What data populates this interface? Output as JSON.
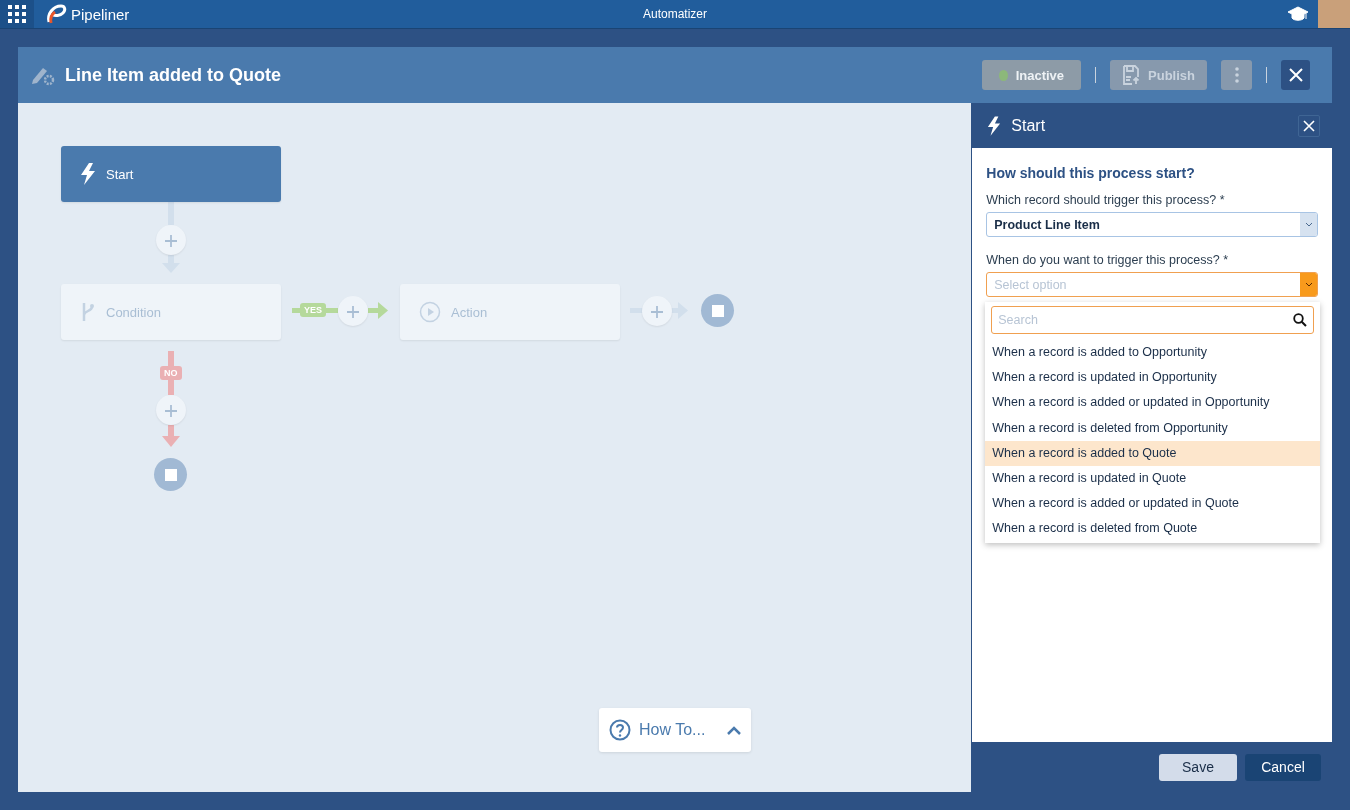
{
  "topbar": {
    "app_name": "Pipeliner",
    "title": "Automatizer"
  },
  "header": {
    "title": "Line Item added to Quote",
    "status_button": {
      "label": "Inactive",
      "disabled": true
    },
    "publish_button": {
      "label": "Publish",
      "disabled": true
    }
  },
  "flow": {
    "nodes": [
      {
        "kind": "start",
        "label": "Start",
        "selected": true
      },
      {
        "kind": "condition",
        "label": "Condition",
        "selected": false
      },
      {
        "kind": "action",
        "label": "Action",
        "selected": false
      }
    ],
    "yes_label": "YES",
    "no_label": "NO"
  },
  "how_to": "How To...",
  "panel": {
    "title": "Start",
    "heading": "How should this process start?",
    "record_field": {
      "label": "Which record should trigger this process? *",
      "value": "Product Line Item"
    },
    "trigger_field": {
      "label": "When do you want to trigger this process? *",
      "placeholder": "Select option",
      "expanded": true
    },
    "search": {
      "placeholder": "Search"
    },
    "options": [
      {
        "label": "When a record is added to Opportunity",
        "selected": false
      },
      {
        "label": "When a record is updated in Opportunity",
        "selected": false
      },
      {
        "label": "When a record is added or updated in Opportunity",
        "selected": false
      },
      {
        "label": "When a record is deleted from Opportunity",
        "selected": false
      },
      {
        "label": "When a record is added to Quote",
        "selected": true
      },
      {
        "label": "When a record is updated in Quote",
        "selected": false
      },
      {
        "label": "When a record is added or updated in Quote",
        "selected": false
      },
      {
        "label": "When a record is deleted from Quote",
        "selected": false
      }
    ],
    "buttons": [
      "Save",
      "Cancel"
    ]
  }
}
